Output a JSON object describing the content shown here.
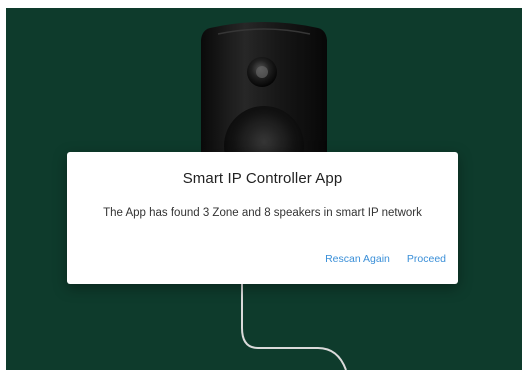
{
  "dialog": {
    "title": "Smart IP Controller App",
    "message": "The App has found 3 Zone and 8 speakers in smart IP network",
    "buttons": {
      "rescan_label": "Rescan Again",
      "proceed_label": "Proceed"
    }
  },
  "colors": {
    "background": "#0f3f2f",
    "dialog_background": "#ffffff",
    "button_text": "#3a8fd8"
  },
  "icons": {
    "illustration": "wall-speaker-illustration"
  }
}
